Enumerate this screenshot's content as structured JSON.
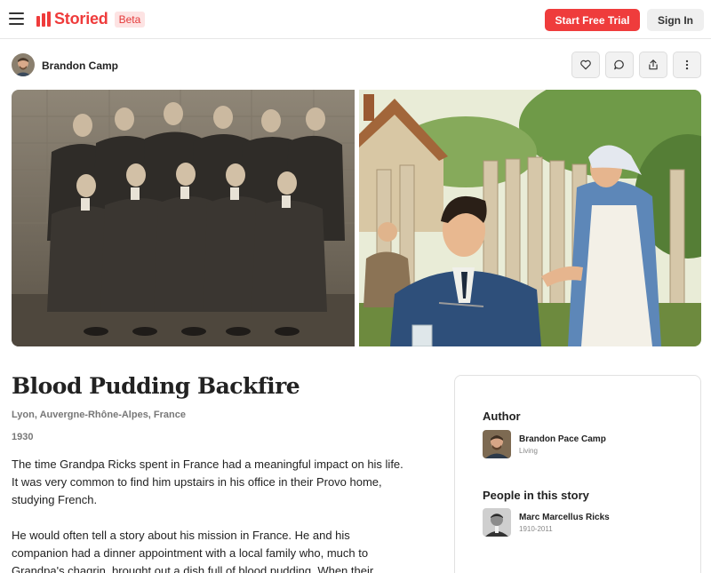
{
  "header": {
    "brand": "Storied",
    "badge": "Beta",
    "trial_label": "Start Free Trial",
    "signin_label": "Sign In",
    "brand_color": "#ef3b3b"
  },
  "story_owner": {
    "name": "Brandon Camp"
  },
  "actions": {
    "icons": [
      "heart-icon",
      "comment-icon",
      "share-icon",
      "more-icon"
    ]
  },
  "story": {
    "title": "Blood Pudding Backfire",
    "place": "Lyon, Auvergne-Rhône-Alpes, France",
    "year": "1930",
    "paragraphs": [
      "The time Grandpa Ricks spent in France had a meaningful impact on his life. It was very common to find him upstairs in his office in their Provo home, studying French.",
      "He would often tell a story about his mission in France. He and his companion had a dinner appointment with a local family who, much to Grandpa's chagrin, brought out a dish full of blood pudding. When their"
    ]
  },
  "sidebar": {
    "author_heading": "Author",
    "author": {
      "name": "Brandon Pace Camp",
      "sub": "Living"
    },
    "people_heading": "People in this story",
    "people": [
      {
        "name": "Marc Marcellus Ricks",
        "sub": "1910-2011"
      }
    ]
  }
}
